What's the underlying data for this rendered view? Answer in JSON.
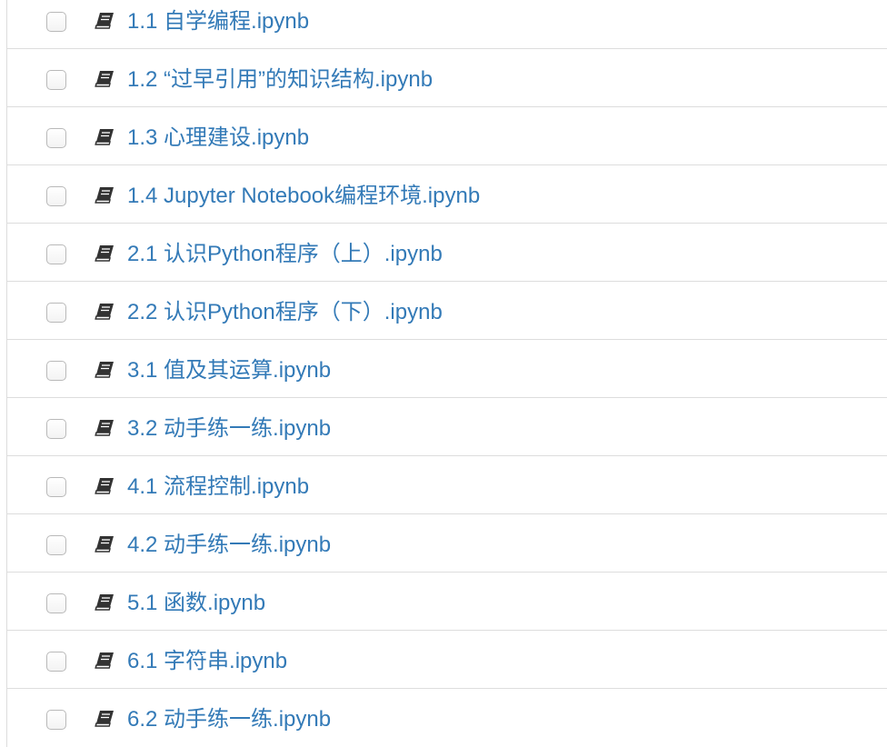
{
  "file_list": {
    "items": [
      {
        "name": "1.1 自学编程.ipynb",
        "icon": "notebook-icon"
      },
      {
        "name": "1.2 “过早引用”的知识结构.ipynb",
        "icon": "notebook-icon"
      },
      {
        "name": "1.3 心理建设.ipynb",
        "icon": "notebook-icon"
      },
      {
        "name": "1.4 Jupyter Notebook编程环境.ipynb",
        "icon": "notebook-icon"
      },
      {
        "name": "2.1 认识Python程序（上）.ipynb",
        "icon": "notebook-icon"
      },
      {
        "name": "2.2 认识Python程序（下）.ipynb",
        "icon": "notebook-icon"
      },
      {
        "name": "3.1 值及其运算.ipynb",
        "icon": "notebook-icon"
      },
      {
        "name": "3.2 动手练一练.ipynb",
        "icon": "notebook-icon"
      },
      {
        "name": "4.1 流程控制.ipynb",
        "icon": "notebook-icon"
      },
      {
        "name": "4.2 动手练一练.ipynb",
        "icon": "notebook-icon"
      },
      {
        "name": "5.1 函数.ipynb",
        "icon": "notebook-icon"
      },
      {
        "name": "6.1 字符串.ipynb",
        "icon": "notebook-icon"
      },
      {
        "name": "6.2 动手练一练.ipynb",
        "icon": "notebook-icon"
      }
    ]
  },
  "colors": {
    "link": "#337ab7",
    "icon": "#333333",
    "divider": "#dddddd",
    "checkbox_border": "#b9b9b9"
  }
}
